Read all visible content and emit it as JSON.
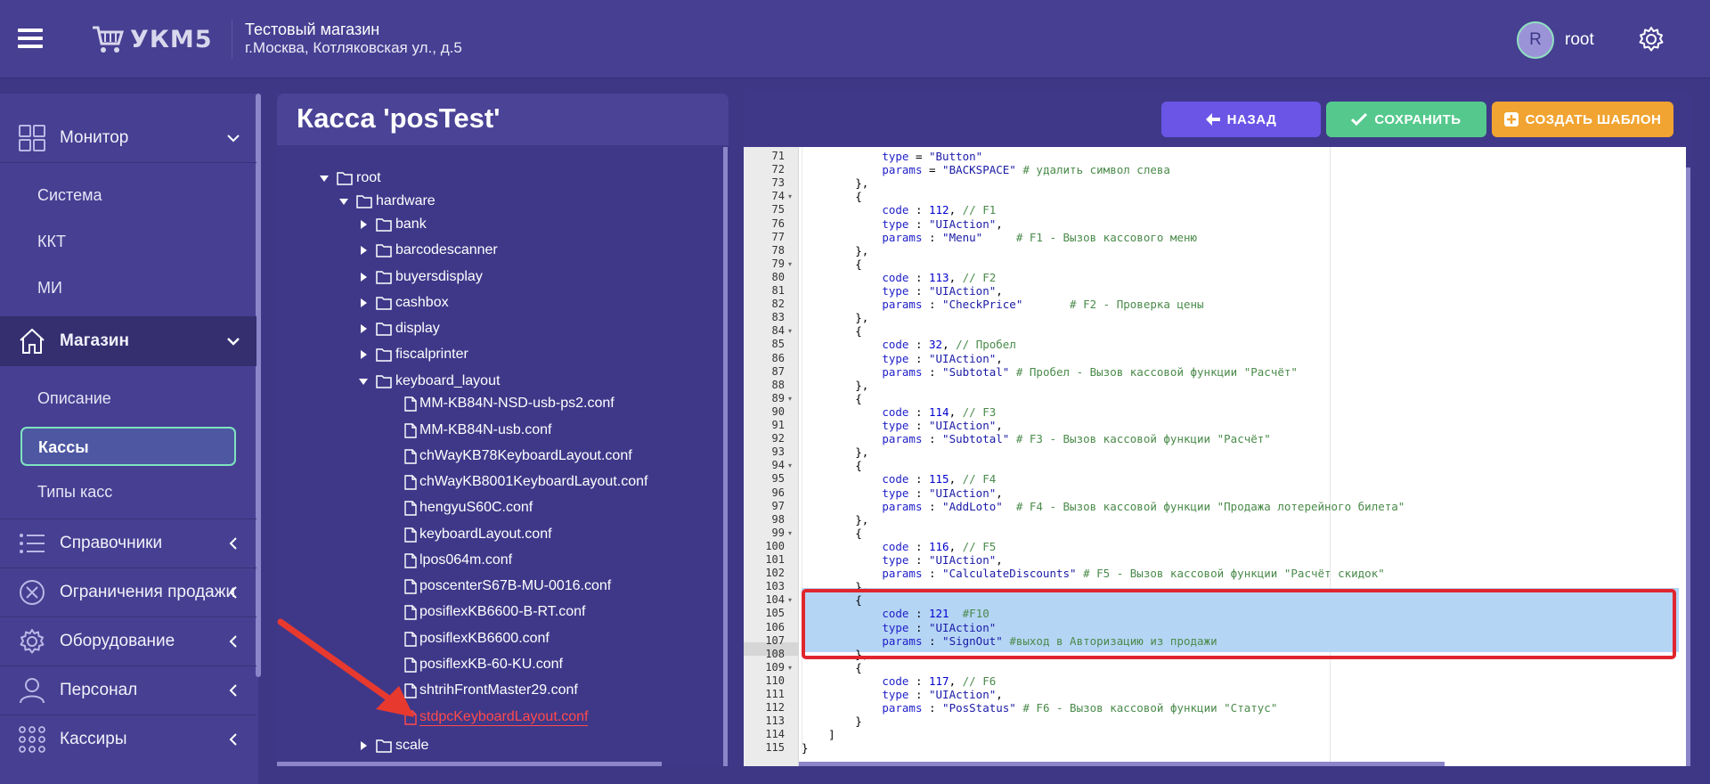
{
  "header": {
    "logo_text": "УКМ5",
    "store_name": "Тестовый магазин",
    "store_address": "г.Москва, Котляковская ул., д.5",
    "avatar_letter": "R",
    "username": "root"
  },
  "sidebar": {
    "monitor": "Монитор",
    "monitor_items": [
      "Система",
      "ККТ",
      "МИ"
    ],
    "shop": "Магазин",
    "shop_items": [
      "Описание",
      "Кассы",
      "Типы касс"
    ],
    "directories": "Справочники",
    "sale_restrictions": "Ограничения продажи",
    "equipment": "Оборудование",
    "personnel": "Персонал",
    "cashiers": "Кассиры"
  },
  "tree": {
    "title": "Касса 'posTest'",
    "root": "root",
    "hardware": "hardware",
    "folders": [
      "bank",
      "barcodescanner",
      "buyersdisplay",
      "cashbox",
      "display",
      "fiscalprinter"
    ],
    "keyboard_layout": "keyboard_layout",
    "files": [
      "MM-KB84N-NSD-usb-ps2.conf",
      "MM-KB84N-usb.conf",
      "chWayKB78KeyboardLayout.conf",
      "chWayKB8001KeyboardLayout.conf",
      "hengyuS60C.conf",
      "keyboardLayout.conf",
      "lpos064m.conf",
      "poscenterS67B-MU-0016.conf",
      "posiflexKB6600-B-RT.conf",
      "posiflexKB6600.conf",
      "posiflexKB-60-KU.conf",
      "shtrihFrontMaster29.conf",
      "stdpcKeyboardLayout.conf"
    ],
    "scale": "scale"
  },
  "toolbar": {
    "back": "НАЗАД",
    "save": "СОХРАНИТЬ",
    "create_template": "СОЗДАТЬ ШАБЛОН"
  },
  "editor": {
    "lines": [
      {
        "n": "71",
        "fold": false,
        "text": "            type = \"Button\""
      },
      {
        "n": "72",
        "fold": false,
        "text": "            params = \"BACKSPACE\" # удалить символ слева"
      },
      {
        "n": "73",
        "fold": false,
        "text": "        },"
      },
      {
        "n": "74",
        "fold": true,
        "text": "        {"
      },
      {
        "n": "75",
        "fold": false,
        "text": "            code : 112, // F1"
      },
      {
        "n": "76",
        "fold": false,
        "text": "            type : \"UIAction\","
      },
      {
        "n": "77",
        "fold": false,
        "text": "            params : \"Menu\"     # F1 - Вызов кассового меню"
      },
      {
        "n": "78",
        "fold": false,
        "text": "        },"
      },
      {
        "n": "79",
        "fold": true,
        "text": "        {"
      },
      {
        "n": "80",
        "fold": false,
        "text": "            code : 113, // F2"
      },
      {
        "n": "81",
        "fold": false,
        "text": "            type : \"UIAction\","
      },
      {
        "n": "82",
        "fold": false,
        "text": "            params : \"CheckPrice\"       # F2 - Проверка цены"
      },
      {
        "n": "83",
        "fold": false,
        "text": "        },"
      },
      {
        "n": "84",
        "fold": true,
        "text": "        {"
      },
      {
        "n": "85",
        "fold": false,
        "text": "            code : 32, // Пробел"
      },
      {
        "n": "86",
        "fold": false,
        "text": "            type : \"UIAction\","
      },
      {
        "n": "87",
        "fold": false,
        "text": "            params : \"Subtotal\" # Пробел - Вызов кассовой функции \"Расчёт\""
      },
      {
        "n": "88",
        "fold": false,
        "text": "        },"
      },
      {
        "n": "89",
        "fold": true,
        "text": "        {"
      },
      {
        "n": "90",
        "fold": false,
        "text": "            code : 114, // F3"
      },
      {
        "n": "91",
        "fold": false,
        "text": "            type : \"UIAction\","
      },
      {
        "n": "92",
        "fold": false,
        "text": "            params : \"Subtotal\" # F3 - Вызов кассовой функции \"Расчёт\""
      },
      {
        "n": "93",
        "fold": false,
        "text": "        },"
      },
      {
        "n": "94",
        "fold": true,
        "text": "        {"
      },
      {
        "n": "95",
        "fold": false,
        "text": "            code : 115, // F4"
      },
      {
        "n": "96",
        "fold": false,
        "text": "            type : \"UIAction\","
      },
      {
        "n": "97",
        "fold": false,
        "text": "            params : \"AddLoto\"  # F4 - Вызов кассовой функции \"Продажа лотерейного билета\""
      },
      {
        "n": "98",
        "fold": false,
        "text": "        },"
      },
      {
        "n": "99",
        "fold": true,
        "text": "        {"
      },
      {
        "n": "100",
        "fold": false,
        "text": "            code : 116, // F5"
      },
      {
        "n": "101",
        "fold": false,
        "text": "            type : \"UIAction\","
      },
      {
        "n": "102",
        "fold": false,
        "text": "            params : \"CalculateDiscounts\" # F5 - Вызов кассовой функции \"Расчёт скидок\""
      },
      {
        "n": "103",
        "fold": false,
        "text": "        },"
      },
      {
        "n": "104",
        "fold": true,
        "text": "        {"
      },
      {
        "n": "105",
        "fold": false,
        "text": "            code : 121  #F10"
      },
      {
        "n": "106",
        "fold": false,
        "text": "            type : \"UIAction\""
      },
      {
        "n": "107",
        "fold": false,
        "text": "            params : \"SignOut\" #выход в Авторизацию из продажи"
      },
      {
        "n": "108",
        "fold": false,
        "text": "        },"
      },
      {
        "n": "109",
        "fold": true,
        "text": "        {"
      },
      {
        "n": "110",
        "fold": false,
        "text": "            code : 117, // F6"
      },
      {
        "n": "111",
        "fold": false,
        "text": "            type : \"UIAction\","
      },
      {
        "n": "112",
        "fold": false,
        "text": "            params : \"PosStatus\" # F6 - Вызов кассовой функции \"Статус\""
      },
      {
        "n": "113",
        "fold": false,
        "text": "        }"
      },
      {
        "n": "114",
        "fold": false,
        "text": "    ]"
      },
      {
        "n": "115",
        "fold": false,
        "text": "}"
      }
    ]
  },
  "colors": {
    "background": "#3d3785",
    "panel": "#463f92",
    "accent_back": "#6a55e6",
    "accent_save": "#55c98d",
    "accent_template": "#f1a431",
    "highlight_box": "#e0262d",
    "selected_file": "#ff4a4a"
  }
}
